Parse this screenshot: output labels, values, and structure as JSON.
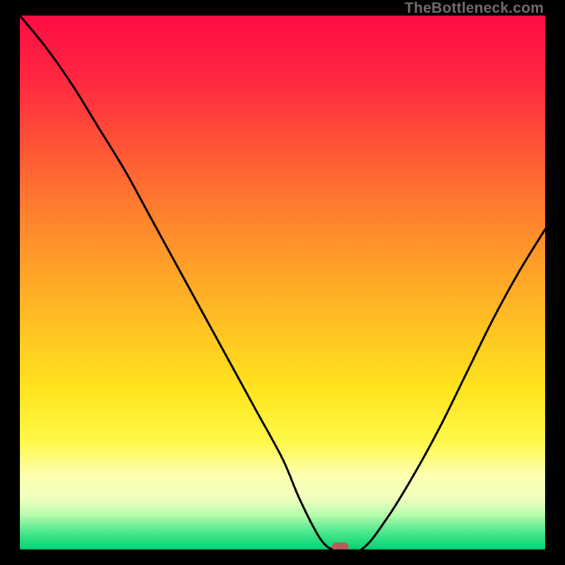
{
  "watermark": "TheBottleneck.com",
  "chart_data": {
    "type": "line",
    "title": "",
    "xlabel": "",
    "ylabel": "",
    "xlim": [
      0,
      100
    ],
    "ylim": [
      0,
      100
    ],
    "grid": false,
    "series": [
      {
        "name": "bottleneck-curve",
        "x": [
          0,
          5,
          10,
          15,
          20,
          25,
          30,
          35,
          40,
          45,
          50,
          53,
          56,
          58,
          60,
          65,
          70,
          75,
          80,
          85,
          90,
          95,
          100
        ],
        "y": [
          100,
          94,
          87,
          79,
          71,
          62,
          53,
          44,
          35,
          26,
          17,
          10,
          4,
          1,
          0,
          0,
          6,
          14,
          23,
          33,
          43,
          52,
          60
        ]
      }
    ],
    "markers": [
      {
        "name": "minimum-marker",
        "x": 61,
        "y": 0.5,
        "color": "#b85a55"
      }
    ],
    "gradient_stops": [
      {
        "offset": 0.0,
        "color": "#ff0d45"
      },
      {
        "offset": 0.12,
        "color": "#ff2740"
      },
      {
        "offset": 0.26,
        "color": "#ff5a35"
      },
      {
        "offset": 0.4,
        "color": "#ff8a2c"
      },
      {
        "offset": 0.55,
        "color": "#ffb824"
      },
      {
        "offset": 0.7,
        "color": "#ffe41e"
      },
      {
        "offset": 0.8,
        "color": "#fff94a"
      },
      {
        "offset": 0.86,
        "color": "#feffb0"
      },
      {
        "offset": 0.905,
        "color": "#f0ffbe"
      },
      {
        "offset": 0.935,
        "color": "#b8fcae"
      },
      {
        "offset": 0.965,
        "color": "#53e98f"
      },
      {
        "offset": 1.0,
        "color": "#00d373"
      }
    ]
  }
}
